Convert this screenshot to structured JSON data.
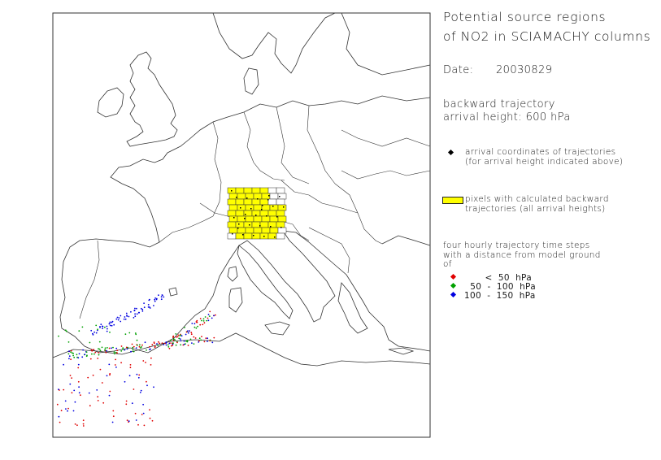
{
  "title": {
    "line1": "Potential source regions",
    "line2": "of NO2 in SCIAMACHY columns"
  },
  "date": {
    "label": "Date:",
    "value": "20030829"
  },
  "trajectory": {
    "line1": "backward trajectory",
    "line2": "arrival height:  600  hPa"
  },
  "legend": {
    "arrival": "arrival coordinates of trajectories (for arrival height indicated above)",
    "pixels": "pixels with calculated backward trajectories (all arrival heights)",
    "steps_intro": "four hourly trajectory time steps with a distance from model ground of",
    "steps": [
      {
        "label": "       <  50  hPa",
        "color": "#e00000"
      },
      {
        "label": "  50  -  100  hPa",
        "color": "#00a000"
      },
      {
        "label": "100  -  150  hPa",
        "color": "#0000e0"
      }
    ],
    "arrival_color": "#000000",
    "pixel_color": "#ffff00"
  }
}
